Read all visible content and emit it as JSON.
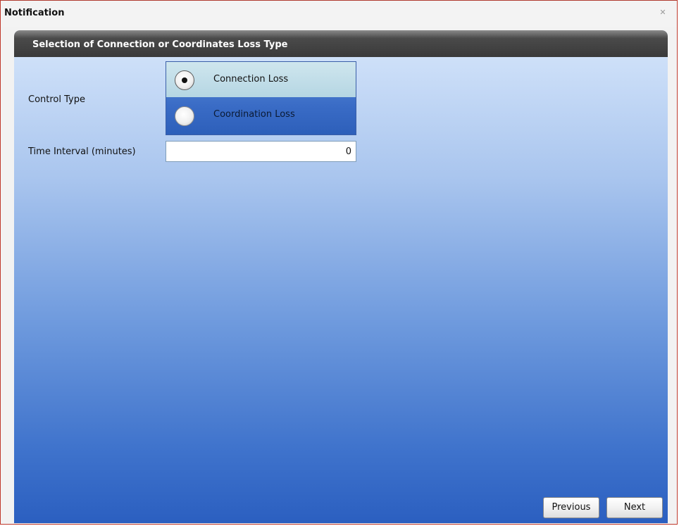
{
  "window": {
    "title": "Notification",
    "close_icon": "close-icon"
  },
  "panel": {
    "header": "Selection of Connection or Coordinates Loss Type"
  },
  "form": {
    "control_type_label": "Control Type",
    "control_type_options": [
      {
        "label": "Connection Loss",
        "selected": true
      },
      {
        "label": "Coordination Loss",
        "selected": false
      }
    ],
    "time_interval_label": "Time Interval (minutes)",
    "time_interval_value": "0"
  },
  "buttons": {
    "previous": "Previous",
    "next": "Next"
  },
  "colors": {
    "panel_gradient_top": "#d6e6fb",
    "panel_gradient_bottom": "#2b5fc0",
    "header_bg": "#3a3a3a",
    "selected_option_bg": "#b5d6e3",
    "window_border": "#c0392b"
  }
}
